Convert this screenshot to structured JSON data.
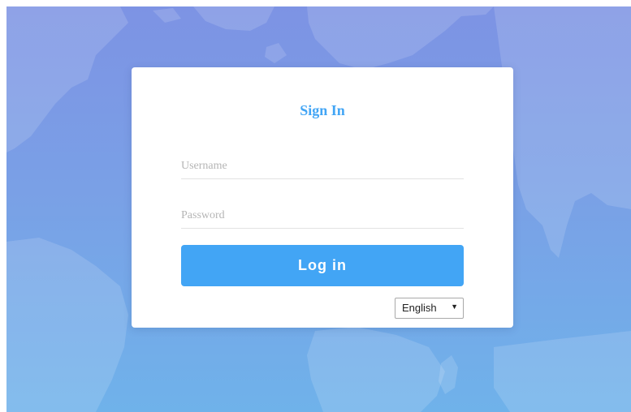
{
  "background": {
    "gradient_top": "#7d93e4",
    "gradient_bottom": "#6fb2ea",
    "decoration": "world-map"
  },
  "login": {
    "title": "Sign In",
    "username_placeholder": "Username",
    "password_placeholder": "Password",
    "login_button": "Log in",
    "language": {
      "selected": "English",
      "arrow_icon": "▼"
    }
  },
  "colors": {
    "accent": "#42a5f5",
    "card": "#ffffff",
    "input_border": "#e3e3e3",
    "placeholder": "#b5b5b5"
  }
}
